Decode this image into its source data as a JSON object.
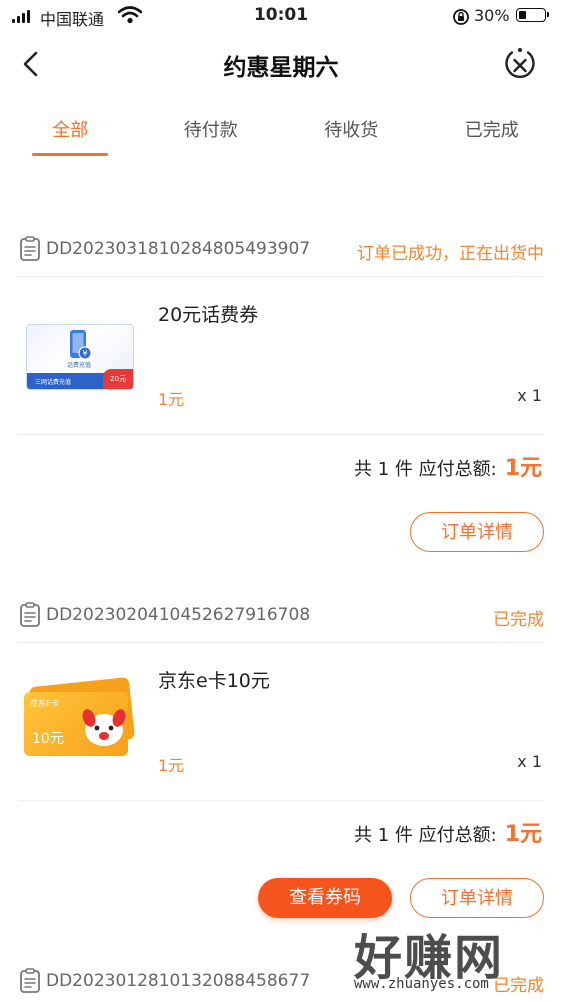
{
  "status_bar": {
    "carrier": "中国联通",
    "time": "10:01",
    "battery": "30%",
    "battery_level": 0.3
  },
  "nav": {
    "title": "约惠星期六"
  },
  "tabs": [
    {
      "label": "全部",
      "active": true
    },
    {
      "label": "待付款",
      "active": false
    },
    {
      "label": "待收货",
      "active": false
    },
    {
      "label": "已完成",
      "active": false
    }
  ],
  "orders": [
    {
      "order_no": "DD2023031810284805493907",
      "status": "订单已成功，正在出货中",
      "product": {
        "name": "20元话费券",
        "price": "1元",
        "qty": "x 1",
        "thumb_caption": "话费充值",
        "thumb_strip": "三网话费充值",
        "thumb_badge": "20元"
      },
      "summary": {
        "prefix": "共 1 件 应付总额:",
        "total": "1元"
      },
      "detail_button": "订单详情"
    },
    {
      "order_no": "DD2023020410452627916708",
      "status": "已完成",
      "product": {
        "name": "京东e卡10元",
        "price": "1元",
        "qty": "x 1",
        "thumb_brand": "京东E卡",
        "thumb_value": "10元"
      },
      "summary": {
        "prefix": "共 1 件 应付总额:",
        "total": "1元"
      },
      "code_button": "查看券码",
      "detail_button": "订单详情"
    },
    {
      "order_no": "DD2023012810132088458677",
      "status": "已完成"
    }
  ],
  "watermark": {
    "main": "好赚网",
    "sub": "www.zhuanyes.com"
  },
  "colors": {
    "accent": "#f2732d",
    "status": "#f2862e",
    "button_fill": "#f5541c"
  }
}
